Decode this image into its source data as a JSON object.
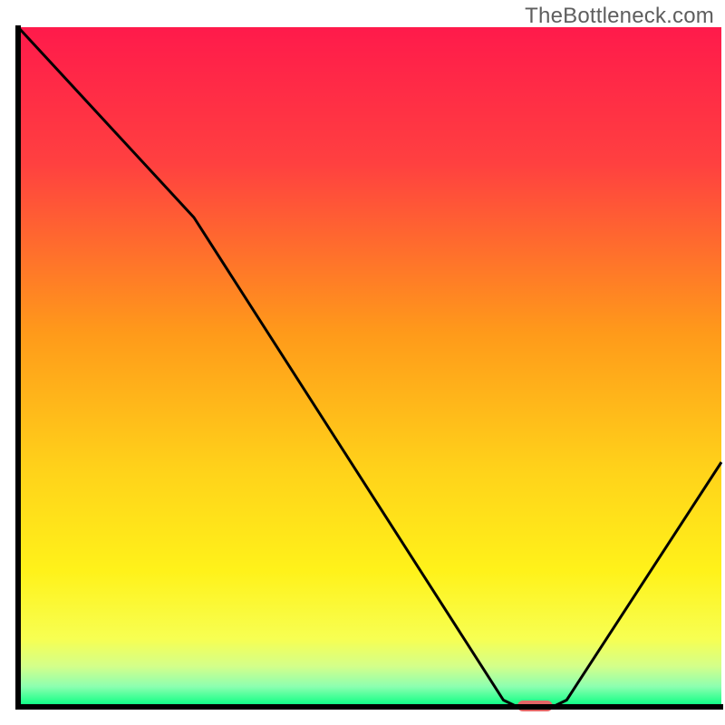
{
  "watermark": "TheBottleneck.com",
  "chart_data": {
    "type": "line",
    "title": "",
    "xlabel": "",
    "ylabel": "",
    "xlim": [
      0,
      100
    ],
    "ylim": [
      0,
      100
    ],
    "optimum_marker": {
      "x_start": 71,
      "x_end": 76,
      "y": 0
    },
    "curve": [
      {
        "x": 0,
        "y": 100
      },
      {
        "x": 25,
        "y": 72
      },
      {
        "x": 69,
        "y": 1
      },
      {
        "x": 71,
        "y": 0
      },
      {
        "x": 76,
        "y": 0
      },
      {
        "x": 78,
        "y": 1
      },
      {
        "x": 100,
        "y": 36
      }
    ],
    "background_gradient_stops": [
      {
        "offset": 0.0,
        "color": "#ff1a4b"
      },
      {
        "offset": 0.2,
        "color": "#ff4040"
      },
      {
        "offset": 0.45,
        "color": "#ff9a1a"
      },
      {
        "offset": 0.65,
        "color": "#ffd21a"
      },
      {
        "offset": 0.8,
        "color": "#fff21a"
      },
      {
        "offset": 0.9,
        "color": "#f7ff52"
      },
      {
        "offset": 0.94,
        "color": "#d4ff8a"
      },
      {
        "offset": 0.97,
        "color": "#8dffb0"
      },
      {
        "offset": 1.0,
        "color": "#00ff80"
      }
    ],
    "marker_color": "#e36666",
    "axis_color": "#000000",
    "curve_color": "#000000"
  }
}
